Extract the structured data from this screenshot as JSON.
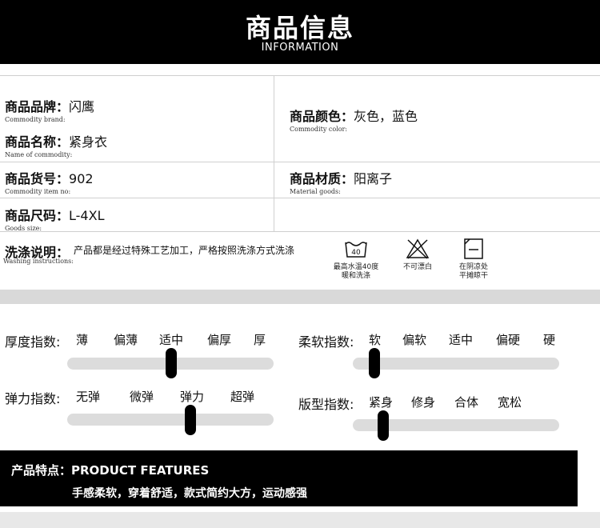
{
  "header": {
    "title": "商品信息",
    "subtitle": "INFORMATION"
  },
  "info": {
    "brand": {
      "label": "商品品牌：",
      "value": "闪鹰",
      "en": "Commodity brand:"
    },
    "name": {
      "label": "商品名称：",
      "value": "紧身衣",
      "en": "Name of commodity:"
    },
    "item_no": {
      "label": "商品货号：",
      "value": "902",
      "en": "Commodity item no:"
    },
    "size": {
      "label": "商品尺码：",
      "value": "L-4XL",
      "en": "Goods size:"
    },
    "color": {
      "label": "商品颜色：",
      "value": "灰色，蓝色",
      "en": "Commodity color:"
    },
    "material": {
      "label": "商品材质：",
      "value": "阳离子",
      "en": "Material goods:"
    }
  },
  "washing": {
    "label": "洗涤说明：",
    "value": "产品都是经过特殊工艺加工，严格按照洗涤方式洗涤",
    "en": "Washing instructions:",
    "icons": [
      {
        "icon": "wash-40-icon",
        "number": "40",
        "caption1": "最高水温40度",
        "caption2": "暖和洗涤"
      },
      {
        "icon": "no-bleach-icon",
        "caption1": "不可漂白",
        "caption2": ""
      },
      {
        "icon": "shade-dry-icon",
        "caption1": "在阴凉处",
        "caption2": "平摊晾干"
      }
    ]
  },
  "metrics": {
    "thickness": {
      "label": "厚度指数:",
      "options": [
        "薄",
        "偏薄",
        "适中",
        "偏厚",
        "厚"
      ],
      "selected": "适中",
      "level": 0.5
    },
    "softness": {
      "label": "柔软指数:",
      "options": [
        "软",
        "偏软",
        "适中",
        "偏硬",
        "硬"
      ],
      "selected": "软",
      "level": 0.0
    },
    "elasticity": {
      "label": "弹力指数:",
      "options": [
        "无弹",
        "微弹",
        "弹力",
        "超弹"
      ],
      "selected": "弹力",
      "level": 0.67
    },
    "fit": {
      "label": "版型指数:",
      "options": [
        "紧身",
        "修身",
        "合体",
        "宽松"
      ],
      "selected": "紧身",
      "level": 0.0
    }
  },
  "features": {
    "title": "产品特点：PRODUCT FEATURES",
    "desc": "手感柔软，穿着舒适，款式简约大方，运动感强"
  },
  "colors": {
    "header_bg": "#000000",
    "band": "#d9d9d9",
    "track": "#dcdcdc",
    "knob": "#000000"
  }
}
